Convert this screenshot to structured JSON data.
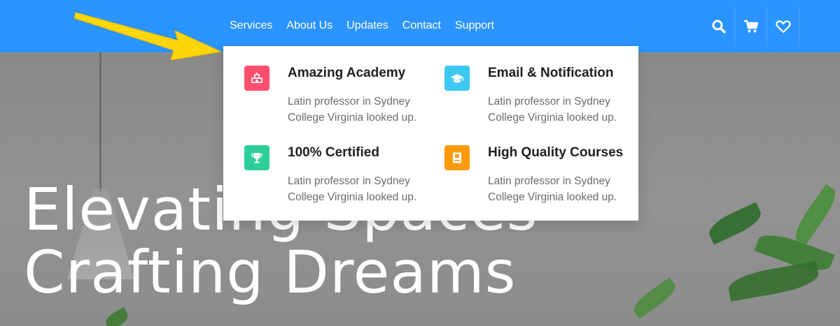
{
  "nav": {
    "links": [
      "Services",
      "About Us",
      "Updates",
      "Contact",
      "Support"
    ],
    "icons": [
      "search-icon",
      "cart-icon",
      "heart-icon"
    ]
  },
  "hero": {
    "title_line1": "Elevating Spaces",
    "title_line2": "Crafting Dreams"
  },
  "dropdown": {
    "items": [
      {
        "title": "Amazing Academy",
        "desc": "Latin professor in Sydney College Virginia looked up.",
        "icon": "academy-icon",
        "color": "#ff4f6e"
      },
      {
        "title": "Email & Notification",
        "desc": "Latin professor in Sydney College Virginia looked up.",
        "icon": "graduation-cap-icon",
        "color": "#3ec9f0"
      },
      {
        "title": "100% Certified",
        "desc": "Latin professor in Sydney College Virginia looked up.",
        "icon": "trophy-icon",
        "color": "#2ecf96"
      },
      {
        "title": "High Quality Courses",
        "desc": "Latin professor in Sydney College Virginia looked up.",
        "icon": "book-icon",
        "color": "#ff9a0d"
      }
    ]
  },
  "colors": {
    "navbar": "#2b94ff",
    "arrow": "#ffd60a"
  }
}
